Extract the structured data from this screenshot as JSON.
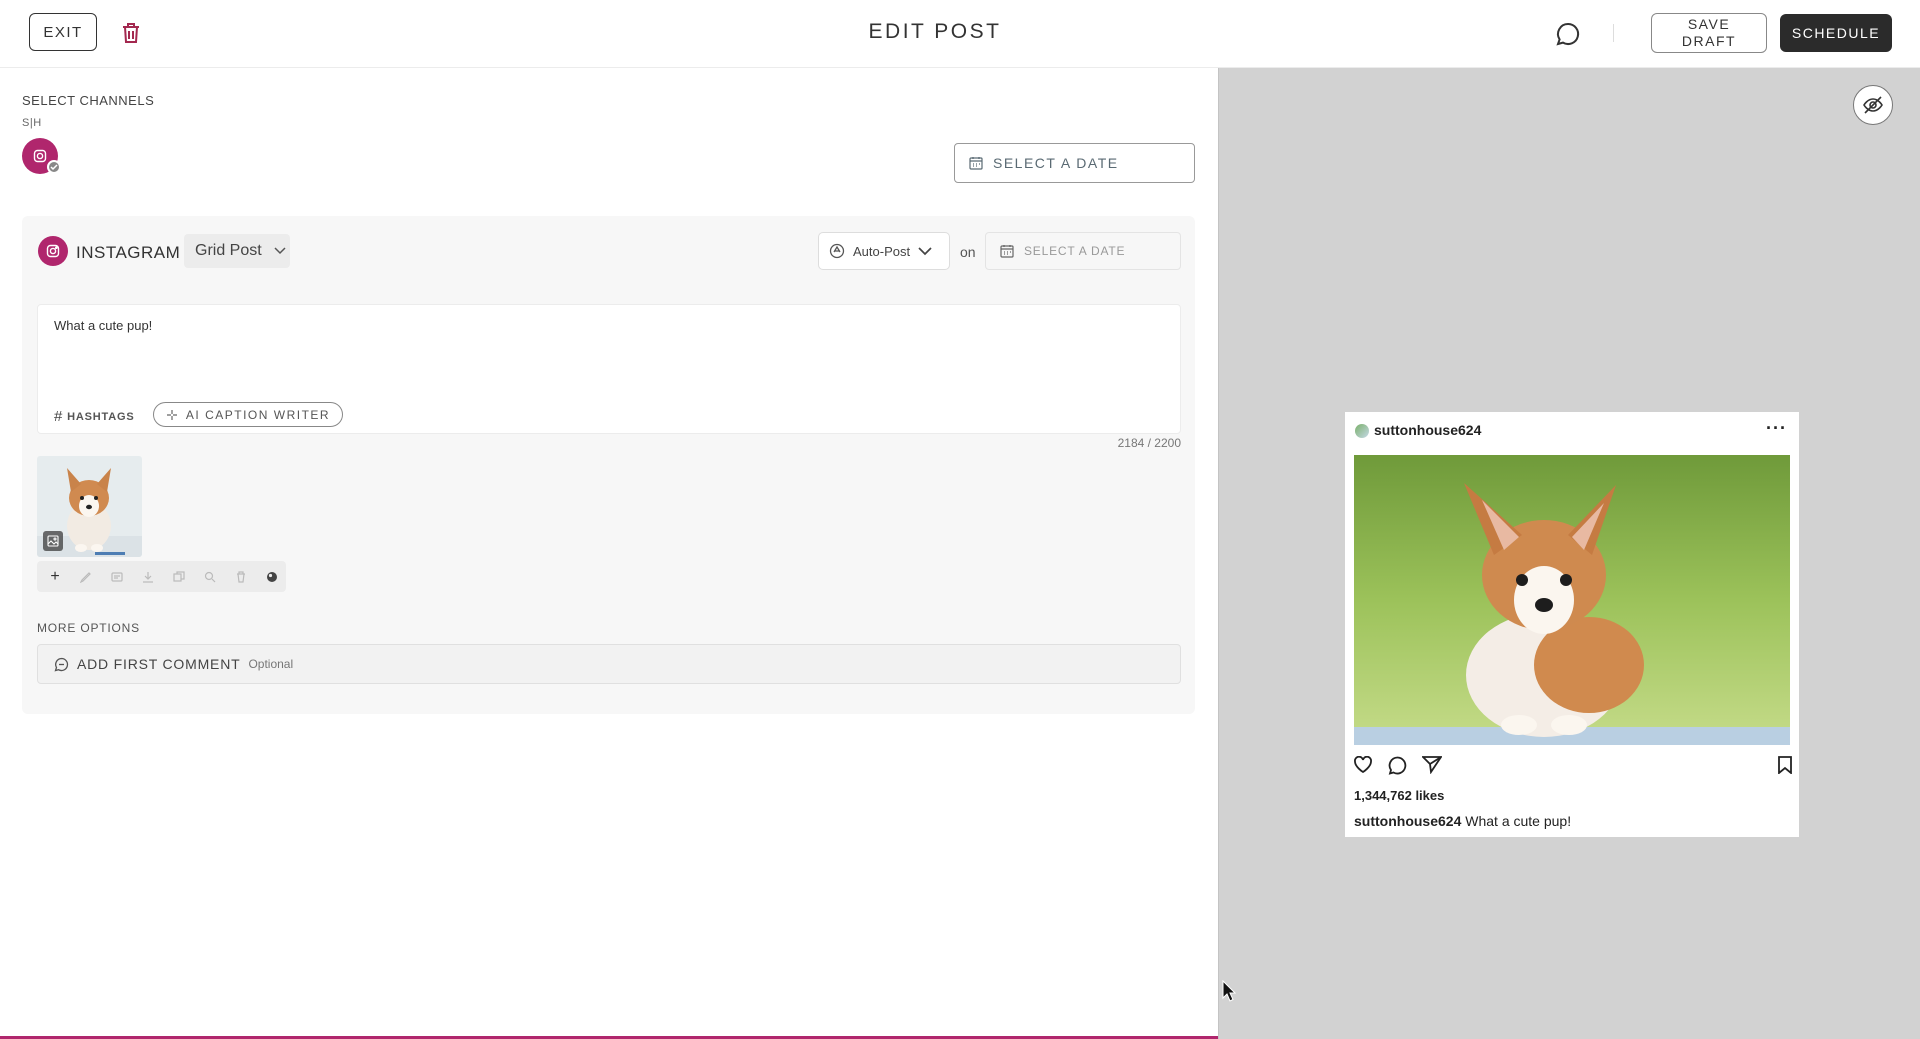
{
  "header": {
    "exit_label": "EXIT",
    "title": "EDIT POST",
    "save_draft_label": "SAVE DRAFT",
    "schedule_label": "SCHEDULE"
  },
  "channels": {
    "section_label": "SELECT CHANNELS",
    "group_label": "S|H",
    "date_placeholder": "SELECT A DATE"
  },
  "instagram": {
    "name": "INSTAGRAM",
    "post_type": "Grid Post",
    "publish_mode": "Auto-Post",
    "on_label": "on",
    "date_placeholder": "SELECT A DATE",
    "caption": "What a cute pup!",
    "hashtags_label": "HASHTAGS",
    "ai_caption_label": "AI CAPTION WRITER",
    "char_count": "2184 / 2200",
    "more_options_label": "MORE OPTIONS",
    "first_comment_label": "ADD FIRST COMMENT",
    "first_comment_optional": "Optional"
  },
  "preview": {
    "username": "suttonhouse624",
    "likes": "1,344,762 likes",
    "caption_user": "suttonhouse624",
    "caption_text": "What a cute pup!"
  },
  "colors": {
    "brand": "#b0266d",
    "dark_button": "#2b2b2b",
    "preview_bg": "#d2d2d2"
  }
}
